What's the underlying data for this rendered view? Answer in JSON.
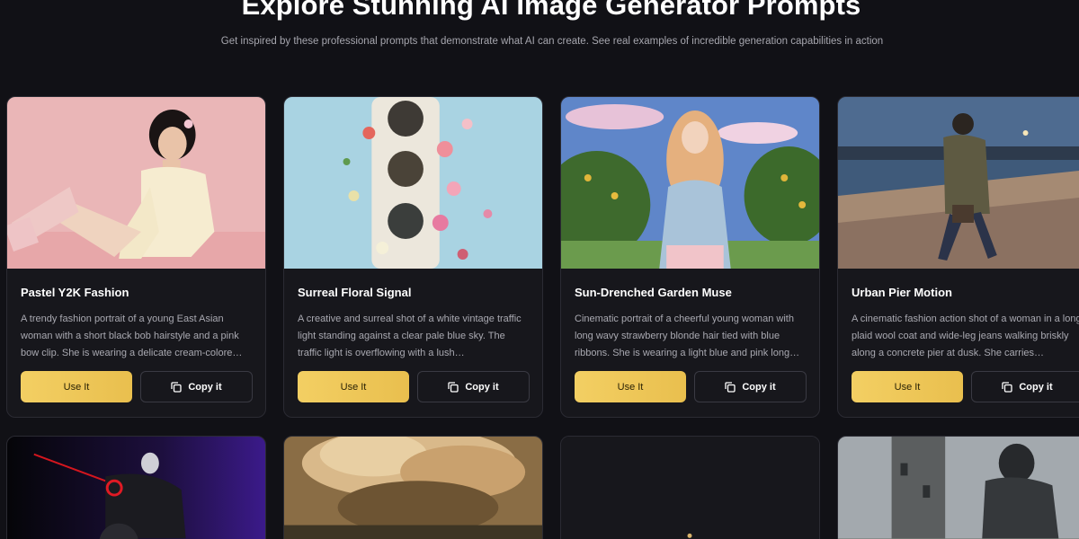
{
  "hero": {
    "title": "Explore Stunning AI Image Generator Prompts",
    "subtitle": "Get inspired by these professional prompts that demonstrate what AI can create. See real examples of incredible generation capabilities in action"
  },
  "buttons": {
    "use_label": "Use It",
    "copy_label": "Copy it"
  },
  "icons": {
    "copy": "copy-icon"
  },
  "colors": {
    "background": "#111116",
    "card": "#17171c",
    "accent_gold": "#f3cf63",
    "muted_text": "#a9a9b1"
  },
  "cards": [
    {
      "title": "Pastel Y2K Fashion",
      "description": "A trendy fashion portrait of a young East Asian woman with a short black bob hairstyle and a pink bow clip. She is wearing a delicate cream-colore…"
    },
    {
      "title": "Surreal Floral Signal",
      "description": "A creative and surreal shot of a white vintage traffic light standing against a clear pale blue sky. The traffic light is overflowing with a lush…"
    },
    {
      "title": "Sun-Drenched Garden Muse",
      "description": "Cinematic portrait of a cheerful young woman with long wavy strawberry blonde hair tied with blue ribbons. She is wearing a light blue and pink long…"
    },
    {
      "title": "Urban Pier Motion",
      "description": "A cinematic fashion action shot of a woman in a long plaid wool coat and wide-leg jeans walking briskly along a concrete pier at dusk. She carries…"
    }
  ]
}
